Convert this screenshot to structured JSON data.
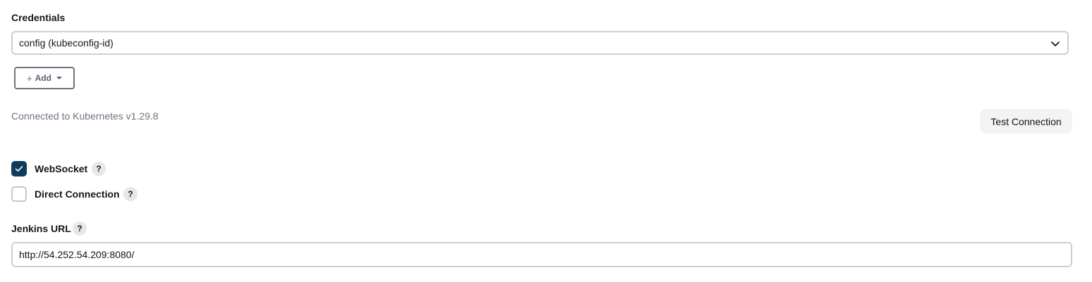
{
  "credentials": {
    "label": "Credentials",
    "selected": "config (kubeconfig-id)",
    "add_button": {
      "icon": "plus-icon",
      "label": "Add"
    }
  },
  "connection": {
    "status": "Connected to Kubernetes v1.29.8",
    "test_button": "Test Connection"
  },
  "options": {
    "websocket": {
      "label": "WebSocket",
      "checked": true,
      "help": "?"
    },
    "direct_connection": {
      "label": "Direct Connection",
      "checked": false,
      "help": "?"
    }
  },
  "jenkins_url": {
    "label": "Jenkins URL",
    "help": "?",
    "value": "http://54.252.54.209:8080/"
  },
  "colors": {
    "checkbox_checked": "#0e3b5c",
    "border": "#c9d2cf",
    "muted_text": "#6d7381"
  }
}
